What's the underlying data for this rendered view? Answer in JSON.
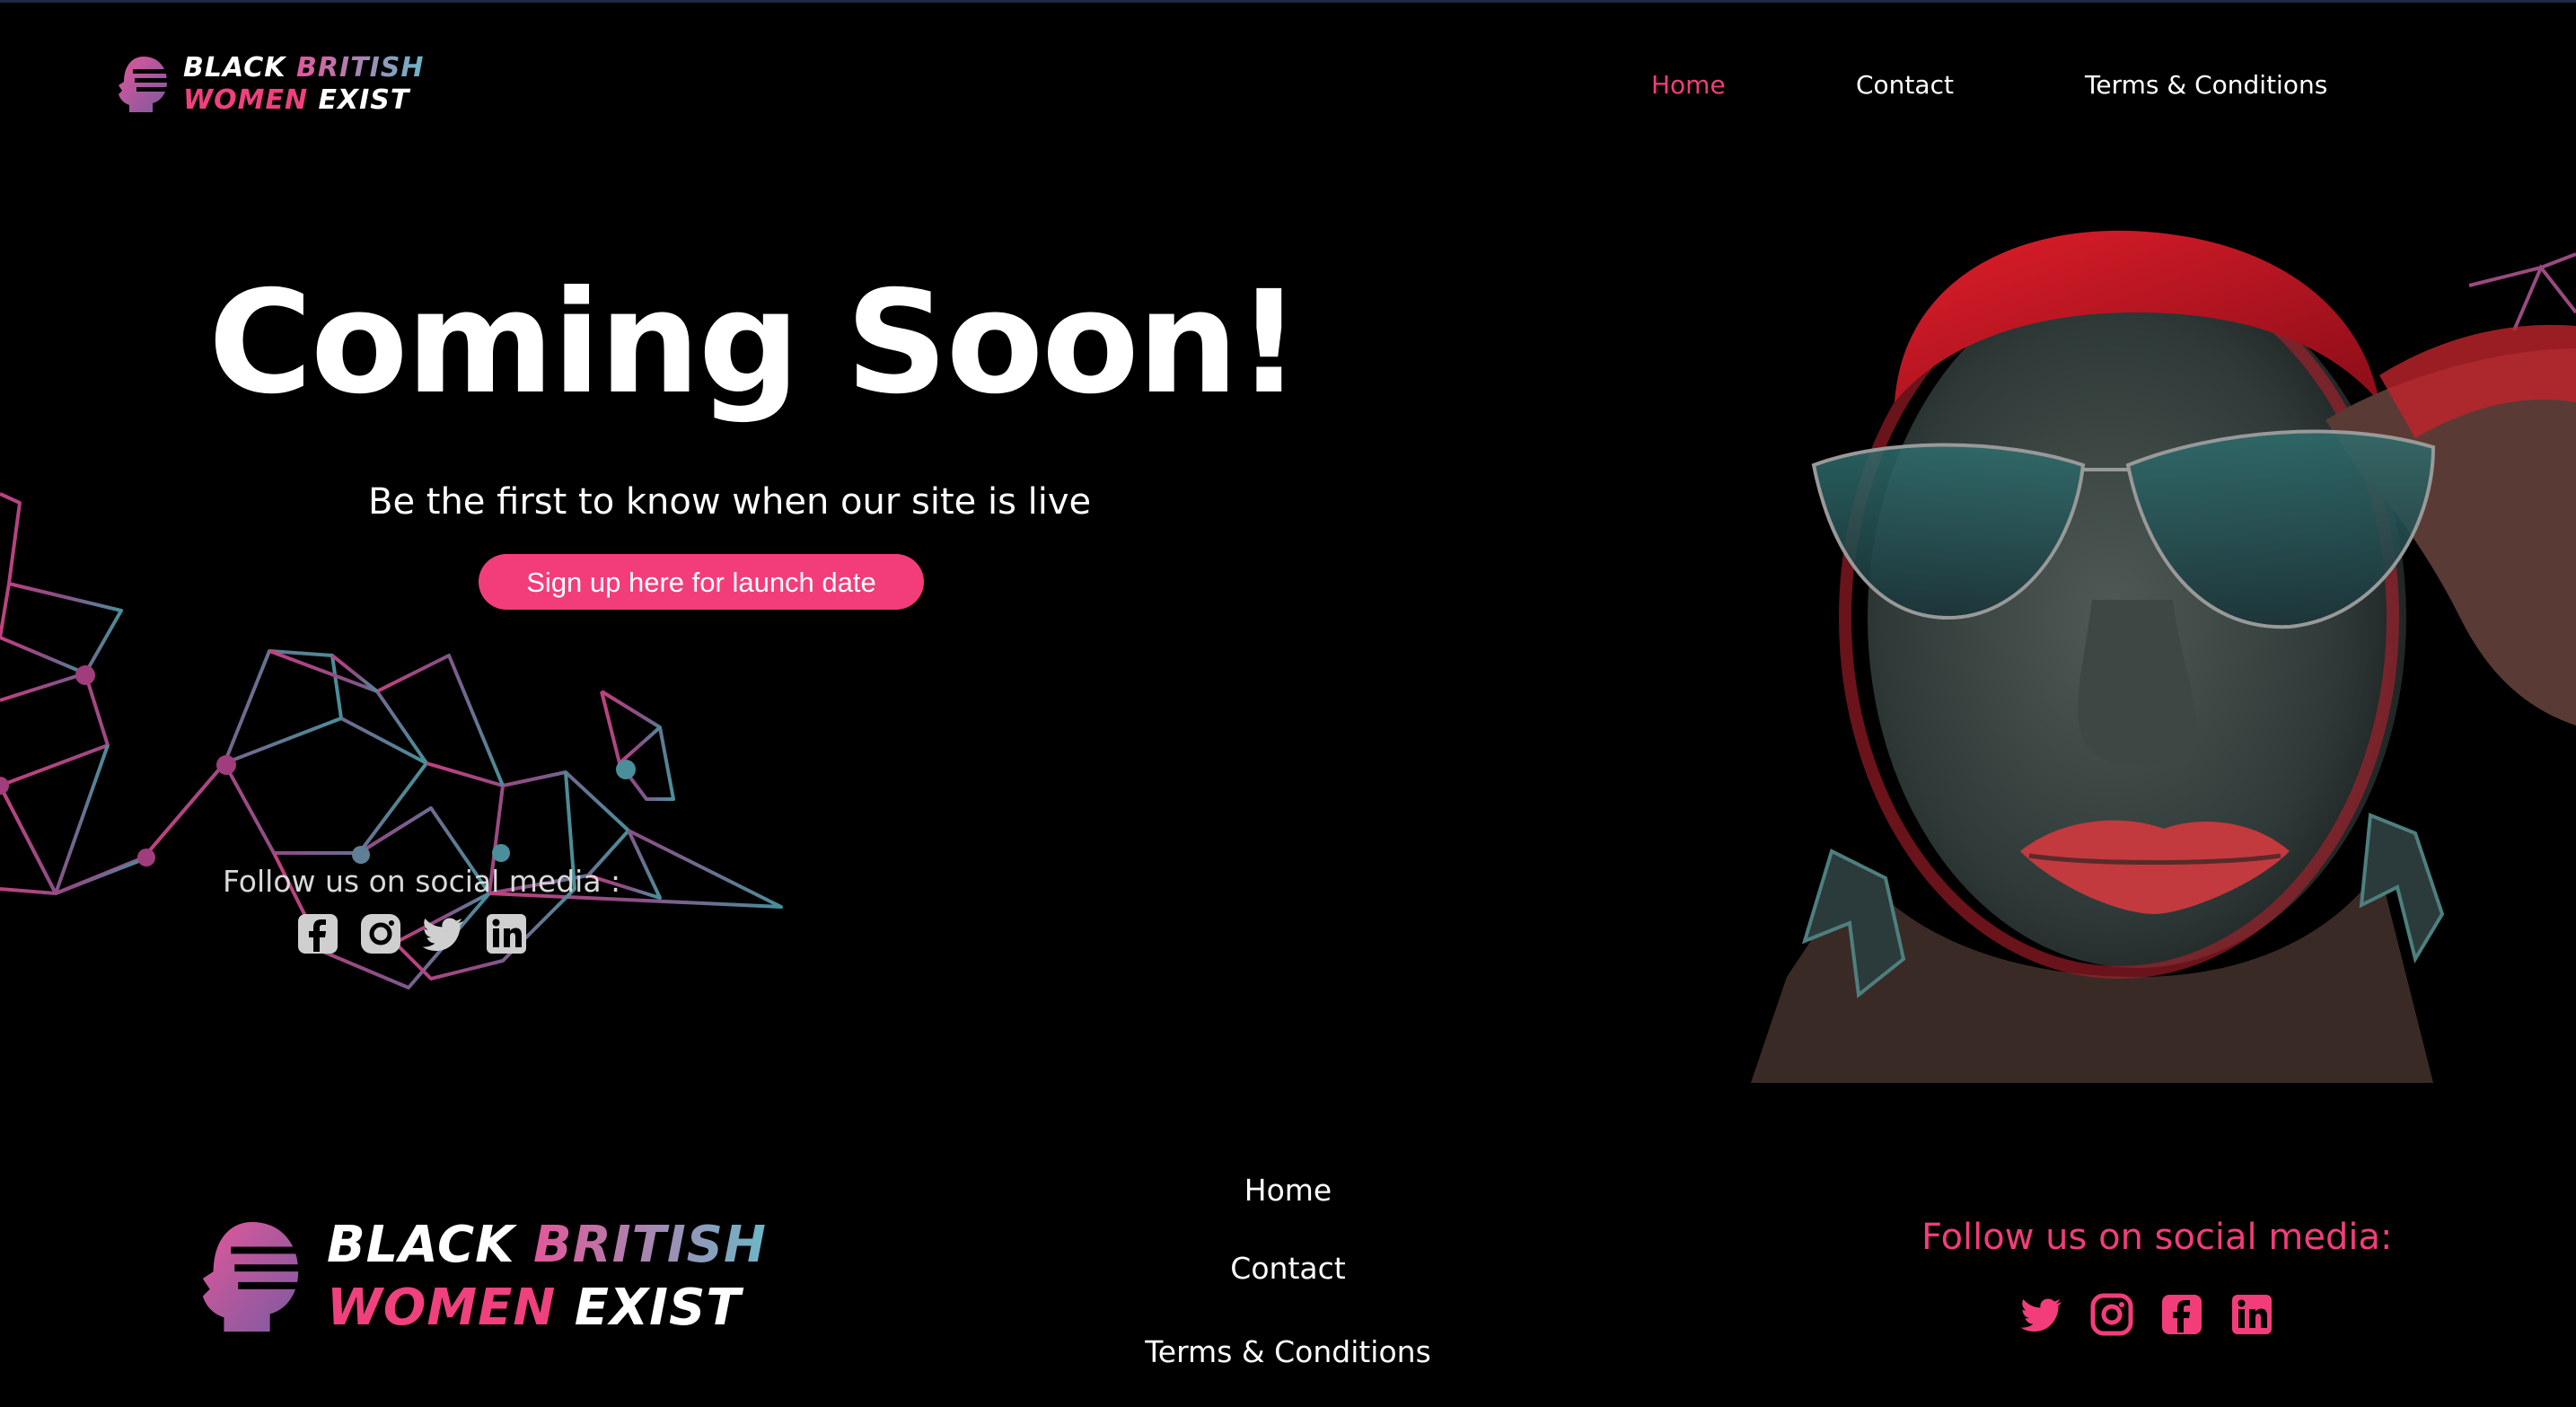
{
  "brand": {
    "line1_word1": "BLACK",
    "line1_word2": "BRITISH",
    "line2_word1": "WOMEN",
    "line2_word2": "EXIST"
  },
  "nav": {
    "items": [
      {
        "label": "Home",
        "active": true
      },
      {
        "label": "Contact",
        "active": false
      },
      {
        "label": "Terms & Conditions",
        "active": false
      }
    ]
  },
  "hero": {
    "title": "Coming Soon!",
    "subtitle": "Be the first to know when our site is live",
    "cta_label": "Sign up here for launch date"
  },
  "social_small": {
    "label": "Follow us on social media :",
    "icons": [
      "facebook-icon",
      "instagram-icon",
      "twitter-icon",
      "linkedin-icon"
    ]
  },
  "footer": {
    "links": [
      "Home",
      "Contact",
      "Terms & Conditions"
    ],
    "follow_label": "Follow us on social media:",
    "icons": [
      "twitter-icon",
      "instagram-icon",
      "facebook-icon",
      "linkedin-icon"
    ]
  },
  "colors": {
    "accent": "#f33d7b",
    "background": "#000000",
    "network_pink": "#c2407e",
    "network_teal": "#4a8f9a"
  }
}
